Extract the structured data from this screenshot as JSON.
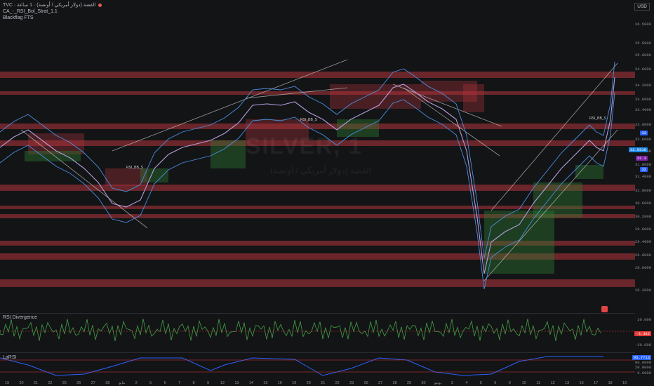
{
  "header": {
    "symbol_line": "TVC · الفضة (دولار أمريكي / أونصة) · 1 ساعة",
    "indicator1": "CA_-_RSI_Bol_Strat_1.1",
    "indicator2": "Blackflag FTS",
    "currency": "USD"
  },
  "watermark": {
    "ticker": "SILVER, 1",
    "subtitle": "الفضة (دولار أمريكي / أونصة)"
  },
  "y_axis": {
    "ticks": [
      "36.5000",
      "35.5000",
      "35.0000",
      "34.6000",
      "34.2000",
      "33.8000",
      "33.4000",
      "33.0000",
      "32.6000",
      "32.2000",
      "31.8000",
      "31.4000",
      "31.0000",
      "30.6000",
      "30.2000",
      "29.8000",
      "29.4000",
      "29.0000",
      "28.6000",
      "28.2000"
    ]
  },
  "price_tags": [
    {
      "label": "33",
      "color": "#2962ff"
    },
    {
      "label": "32.5518",
      "color": "#1e88e5"
    },
    {
      "label": "32.3",
      "color": "#7b1fa2"
    },
    {
      "label": "32",
      "color": "#2962ff"
    }
  ],
  "markers": [
    {
      "text": "RSI_BB_S"
    },
    {
      "text": "RSI_BB_S"
    },
    {
      "text": "RSI_BB_S"
    }
  ],
  "panes": {
    "rsi_divergence": {
      "label": "RSI Divergence",
      "ticks": [
        "20.000",
        "-20.000"
      ],
      "value": "-3.382",
      "value_color": "#e53935"
    },
    "larsi": {
      "label": "LaRSI",
      "ticks": [
        "80.0000",
        "20.0000",
        "0.0000"
      ],
      "value": "95.7713",
      "value_color": "#2962ff"
    }
  },
  "x_axis": {
    "labels": [
      "19",
      "20",
      "21",
      "22",
      "25",
      "26",
      "27",
      "28",
      "مايو",
      "2",
      "5",
      "6",
      "7",
      "8",
      "9",
      "12",
      "13",
      "14",
      "15",
      "16",
      "19",
      "20",
      "21",
      "22",
      "23",
      "26",
      "27",
      "28",
      "29",
      "30",
      "يونيو",
      "3",
      "4",
      "5",
      "6",
      "9",
      "10",
      "11",
      "12",
      "13",
      "16",
      "17",
      "18",
      "19"
    ]
  },
  "colors": {
    "resistance": "#b3353d",
    "support": "#2e7d32",
    "price": "#b39ddb",
    "bands": "#4a8fe0",
    "trendline": "#d0d0d0"
  }
}
